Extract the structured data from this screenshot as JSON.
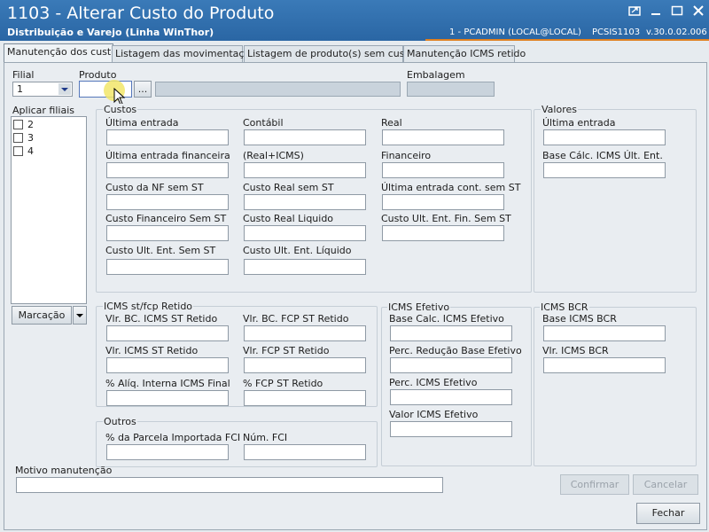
{
  "window": {
    "title": "1103 - Alterar Custo do Produto",
    "subtitle": "Distribuição e Varejo (Linha WinThor)",
    "user": "1 - PCADMIN (LOCAL@LOCAL)",
    "routine": "PCSIS1103",
    "version": "v.30.0.02.006"
  },
  "tabs": [
    {
      "label": "Manutenção dos custos"
    },
    {
      "label": "Listagem das movimentações"
    },
    {
      "label": "Listagem de produto(s)  sem custos"
    },
    {
      "label": "Manutenção ICMS retido"
    }
  ],
  "top": {
    "filial_label": "Filial",
    "filial_value": "1",
    "produto_label": "Produto",
    "produto_button": "...",
    "embalagem_label": "Embalagem"
  },
  "filiais": {
    "label": "Aplicar filiais",
    "items": [
      "2",
      "3",
      "4"
    ],
    "marcacao_button": "Marcação"
  },
  "custos": {
    "title": "Custos",
    "fields": [
      "Última entrada",
      "Contábil",
      "Real",
      "Última entrada financeira",
      "(Real+ICMS)",
      "Financeiro",
      "Custo da NF sem ST",
      "Custo Real sem ST",
      "Última entrada cont. sem ST",
      "Custo Financeiro Sem ST",
      "Custo Real Liquido",
      "Custo Ult. Ent. Fin. Sem ST",
      "Custo Ult. Ent. Sem ST",
      "Custo Ult. Ent. Líquido"
    ]
  },
  "valores": {
    "title": "Valores",
    "fields": [
      "Última entrada",
      "Base Cálc. ICMS Últ. Ent."
    ]
  },
  "icms_st": {
    "title": "ICMS st/fcp Retido",
    "fields": [
      "Vlr. BC. ICMS ST Retido",
      "Vlr. BC. FCP ST Retido",
      "Vlr. ICMS ST Retido",
      "Vlr. FCP ST Retido",
      "% Alíq. Interna ICMS Final",
      "% FCP ST Retido"
    ]
  },
  "icms_efetivo": {
    "title": "ICMS Efetivo",
    "fields": [
      "Base Calc. ICMS Efetivo",
      "Perc. Redução Base Efetivo",
      "Perc. ICMS Efetivo",
      "Valor ICMS Efetivo"
    ]
  },
  "icms_bcr": {
    "title": "ICMS BCR",
    "fields": [
      "Base ICMS BCR",
      "Vlr. ICMS BCR"
    ]
  },
  "outros": {
    "title": "Outros",
    "fields": [
      "% da Parcela Importada FCI",
      "Núm. FCI"
    ]
  },
  "bottom": {
    "motivo_label": "Motivo manutenção",
    "confirmar": "Confirmar",
    "cancelar": "Cancelar",
    "fechar": "Fechar"
  },
  "colors": {
    "titlebar": "#2f6fae",
    "accent": "#e08020",
    "highlight": "#f2e66a"
  }
}
